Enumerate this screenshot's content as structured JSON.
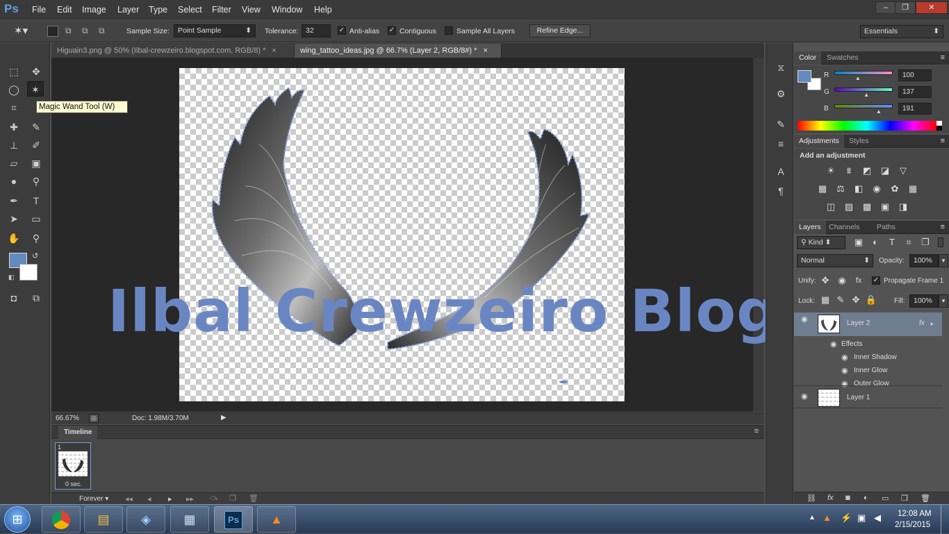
{
  "app": {
    "logo": "Ps"
  },
  "menu": [
    "File",
    "Edit",
    "Image",
    "Layer",
    "Type",
    "Select",
    "Filter",
    "View",
    "Window",
    "Help"
  ],
  "window_controls": {
    "minimize": "–",
    "restore": "❐",
    "close": "✕"
  },
  "options": {
    "sample_size_label": "Sample Size:",
    "sample_size_value": "Point Sample",
    "tolerance_label": "Tolerance:",
    "tolerance_value": "32",
    "antialias_label": "Anti-alias",
    "contiguous_label": "Contiguous",
    "sample_all_label": "Sample All Layers",
    "refine_edge_label": "Refine Edge...",
    "workspace": "Essentials"
  },
  "tooltip": "Magic Wand Tool (W)",
  "doc_tabs": [
    {
      "label": "Higuain3.png @ 50% (Ilbal-crewzeiro.blogspot.com, RGB/8) *"
    },
    {
      "label": "wing_tattoo_ideas.jpg @ 66.7% (Layer 2, RGB/8#) *"
    }
  ],
  "tab_close": "×",
  "canvas": {
    "watermark": "Ilbal Crewzeiro Blog"
  },
  "status": {
    "zoom": "66.67%",
    "doc": "Doc: 1.98M/3.70M"
  },
  "timeline": {
    "title": "Timeline",
    "frame_number": "1",
    "frame_delay": "0 sec.",
    "loop": "Forever",
    "controls": [
      "◂◂",
      "◂",
      "▸",
      "▸▸"
    ]
  },
  "color_panel": {
    "tabs": [
      "Color",
      "Swatches"
    ],
    "r_label": "R",
    "g_label": "G",
    "b_label": "B",
    "r": "100",
    "g": "137",
    "b": "191",
    "foreground": "#6489bf",
    "background": "#ffffff",
    "r_fraction": 0.392,
    "g_fraction": 0.537,
    "b_fraction": 0.749
  },
  "adjustments": {
    "tabs": [
      "Adjustments",
      "Styles"
    ],
    "title": "Add an adjustment",
    "icons": [
      "brightness-icon",
      "levels-icon",
      "curves-icon",
      "exposure-icon",
      "vibrance-icon",
      "hue-saturation-icon",
      "color-balance-icon",
      "black-white-icon",
      "photo-filter-icon",
      "channel-mixer-icon",
      "color-lookup-icon",
      "invert-icon",
      "posterize-icon",
      "threshold-icon",
      "gradient-map-icon",
      "selective-color-icon"
    ]
  },
  "layers": {
    "tabs": [
      "Layers",
      "Channels",
      "Paths"
    ],
    "kind": "Kind",
    "blend_mode": "Normal",
    "opacity_label": "Opacity:",
    "opacity": "100%",
    "unify_label": "Unify:",
    "propagate_label": "Propagate Frame 1",
    "lock_label": "Lock:",
    "fill_label": "Fill:",
    "fill": "100%",
    "fx_badge": "fx",
    "items": [
      {
        "name": "Layer 2"
      },
      {
        "name": "Effects"
      },
      {
        "name": "Inner Shadow"
      },
      {
        "name": "Inner Glow"
      },
      {
        "name": "Outer Glow"
      },
      {
        "name": "Layer 1"
      }
    ],
    "footer_fx": "fx"
  },
  "taskbar": {
    "time": "12:08 AM",
    "date": "2/15/2015",
    "ps_label": "Ps"
  }
}
